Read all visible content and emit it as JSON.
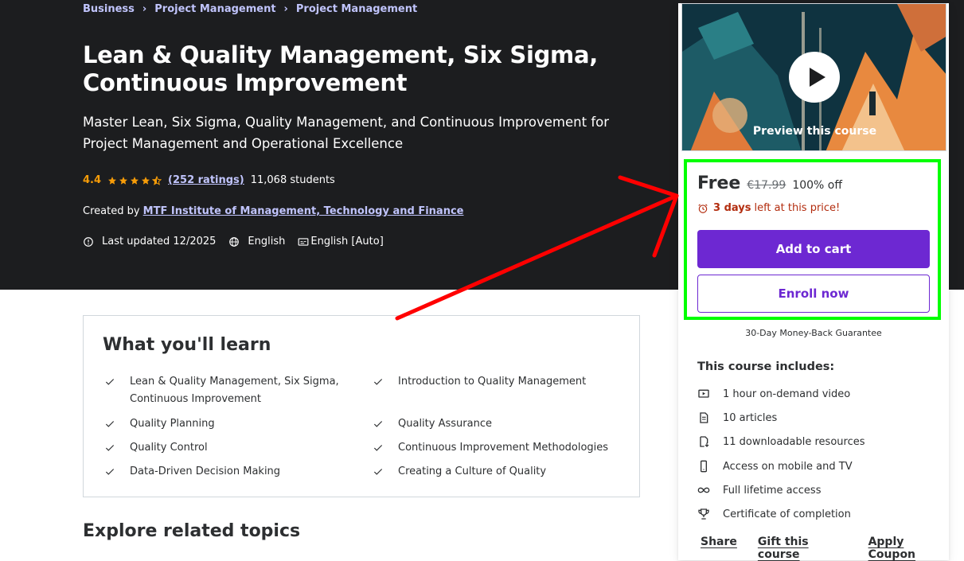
{
  "breadcrumb": [
    "Business",
    "Project Management",
    "Project Management"
  ],
  "course": {
    "title": "Lean & Quality Management, Six Sigma, Continuous Improvement",
    "subtitle": "Master Lean, Six Sigma, Quality Management, and Continuous Improvement for Project Management and Operational Excellence",
    "rating": "4.4",
    "ratings_count": "(252 ratings)",
    "students": "11,068 students",
    "created_by_label": "Created by",
    "instructor": "MTF Institute of Management, Technology and Finance",
    "last_updated": "Last updated 12/2025",
    "language": "English",
    "captions": "English [Auto]"
  },
  "learn": {
    "title": "What you'll learn",
    "items": [
      "Lean & Quality Management, Six Sigma, Continuous Improvement",
      "Introduction to Quality Management",
      "Quality Planning",
      "Quality Assurance",
      "Quality Control",
      "Continuous Improvement Methodologies",
      "Data-Driven Decision Making",
      "Creating a Culture of Quality"
    ]
  },
  "explore_title": "Explore related topics",
  "sidebar": {
    "preview_label": "Preview this course",
    "price": "Free",
    "original_price": "€17.99",
    "discount": "100% off",
    "timer_days": "3 days",
    "timer_suffix": "left at this price!",
    "add_to_cart": "Add to cart",
    "enroll_now": "Enroll now",
    "guarantee": "30-Day Money-Back Guarantee",
    "includes_title": "This course includes:",
    "includes": [
      {
        "icon": "video-icon",
        "text": "1 hour on-demand video"
      },
      {
        "icon": "article-icon",
        "text": "10 articles"
      },
      {
        "icon": "download-icon",
        "text": "11 downloadable resources"
      },
      {
        "icon": "mobile-icon",
        "text": "Access on mobile and TV"
      },
      {
        "icon": "infinity-icon",
        "text": "Full lifetime access"
      },
      {
        "icon": "trophy-icon",
        "text": "Certificate of completion"
      }
    ],
    "actions": [
      "Share",
      "Gift this course",
      "Apply Coupon"
    ]
  },
  "colors": {
    "hero_bg": "#1c1d1f",
    "link": "#c0c4fc",
    "rating": "#f69c08",
    "brand_purple": "#6d28d2",
    "timer_red": "#b32d0f",
    "annotation_green": "#00ff00",
    "annotation_red": "#ff0000"
  }
}
